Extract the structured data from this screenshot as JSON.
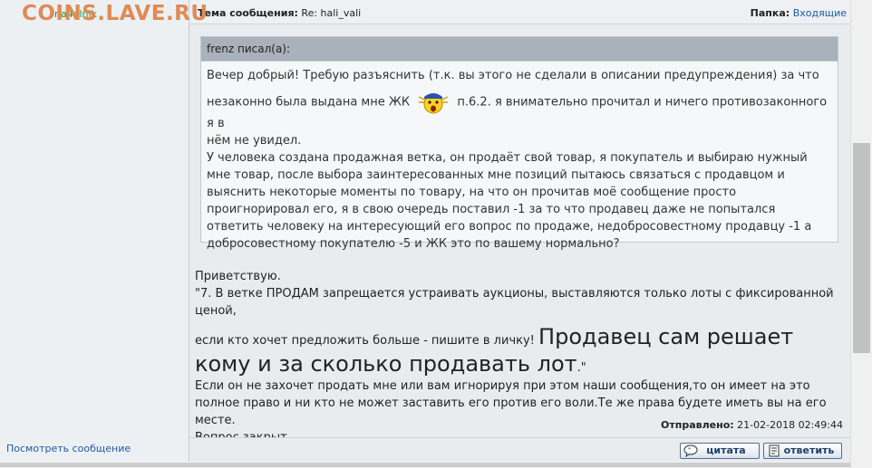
{
  "watermark": "COINS.LAVE.RU",
  "author": "na4alnik",
  "header": {
    "subject_label": "Тема сообщения:",
    "subject_value": "Re: hali_vali",
    "folder_label": "Папка:",
    "folder_value": "Входящие"
  },
  "quote": {
    "author_line": "frenz писал(а):",
    "line1": "Вечер добрый! Требую разъяснить (т.к. вы этого не сделали в описании предупреждения) за что",
    "line2_a": "незаконно была выдана мне ЖК",
    "line2_b": "п.6.2. я внимательно прочитал и ничего противозаконного я в",
    "line3": "нём не увидел.",
    "para2": "У человека создана продажная ветка, он продаёт свой товар, я покупатель и выбираю нужный мне товар, после выбора заинтересованных мне позиций пытаюсь связаться с продавцом и выяснить некоторые моменты по товару, на что он прочитав моё сообщение просто проигнорировал его, я в свою очередь поставил -1 за то что продавец даже не попытался ответить человеку на интересующий его вопрос по продаже, недобросовестному продавцу -1 а добросовестному покупателю -5 и ЖК это по вашему нормально?"
  },
  "message": {
    "greeting": "Приветствую.",
    "rule_line": "\"7. В ветке ПРОДАМ запрещается устраивать аукционы, выставляются только лоты с фиксированной ценой,",
    "rule_line2": "если кто хочет предложить больше - пишите в личку!",
    "big_text": "Продавец сам решает кому и за сколько продавать лот",
    "big_end": ".\"",
    "para": "Если он не захочет продать мне или вам игнорируя при этом наши сообщения,то он имеет на это полное право и ни кто не может заставить его против его воли.Те же права будете иметь вы на его месте.",
    "closing": "Вопрос закрыт."
  },
  "posted": {
    "label": "Отправлено:",
    "value": "21-02-2018 02:49:44"
  },
  "footer": {
    "view_message": "Посмотреть сообщение",
    "quote_button": "цитата",
    "reply_button": "ответить"
  }
}
